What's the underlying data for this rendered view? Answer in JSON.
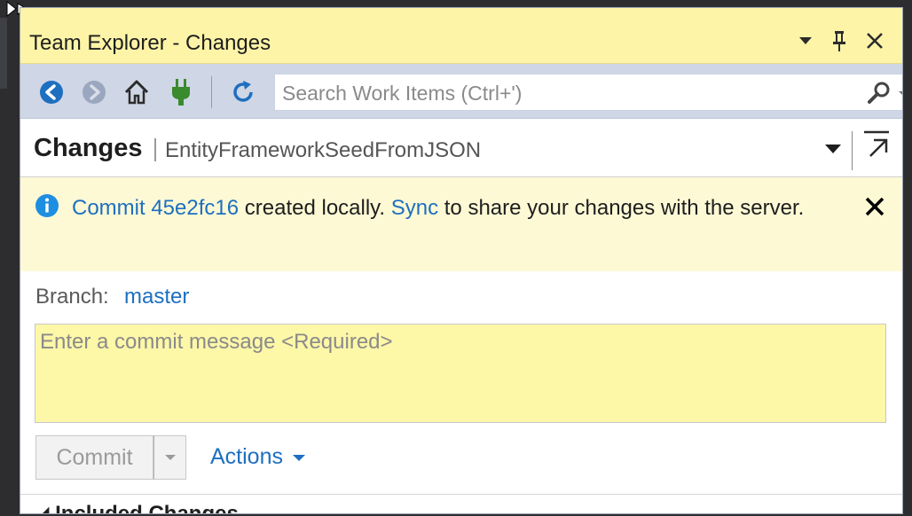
{
  "window": {
    "title": "Team Explorer - Changes"
  },
  "toolbar": {
    "buttons": [
      "back-icon",
      "forward-icon",
      "home-icon",
      "connect-icon",
      "refresh-icon"
    ],
    "search_placeholder": "Search Work Items (Ctrl+')"
  },
  "page": {
    "title": "Changes",
    "repository": "EntityFrameworkSeedFromJSON"
  },
  "notification": {
    "commit_label": "Commit 45e2fc16",
    "text_middle": " created locally. ",
    "sync_label": "Sync",
    "text_end": " to share your changes with the server."
  },
  "branch": {
    "label": "Branch:",
    "value": "master"
  },
  "commit_message": {
    "placeholder": "Enter a commit message <Required>",
    "value": ""
  },
  "commit_button": {
    "label": "Commit"
  },
  "actions": {
    "label": "Actions"
  },
  "section": {
    "label": "Included Changes"
  },
  "colors": {
    "accent": "#1e6fc0",
    "title_bar": "#fdf4a7",
    "toolbar": "#cfd6e5",
    "info_bar": "#fdf9d5",
    "input_bg": "#fdf7a8"
  }
}
